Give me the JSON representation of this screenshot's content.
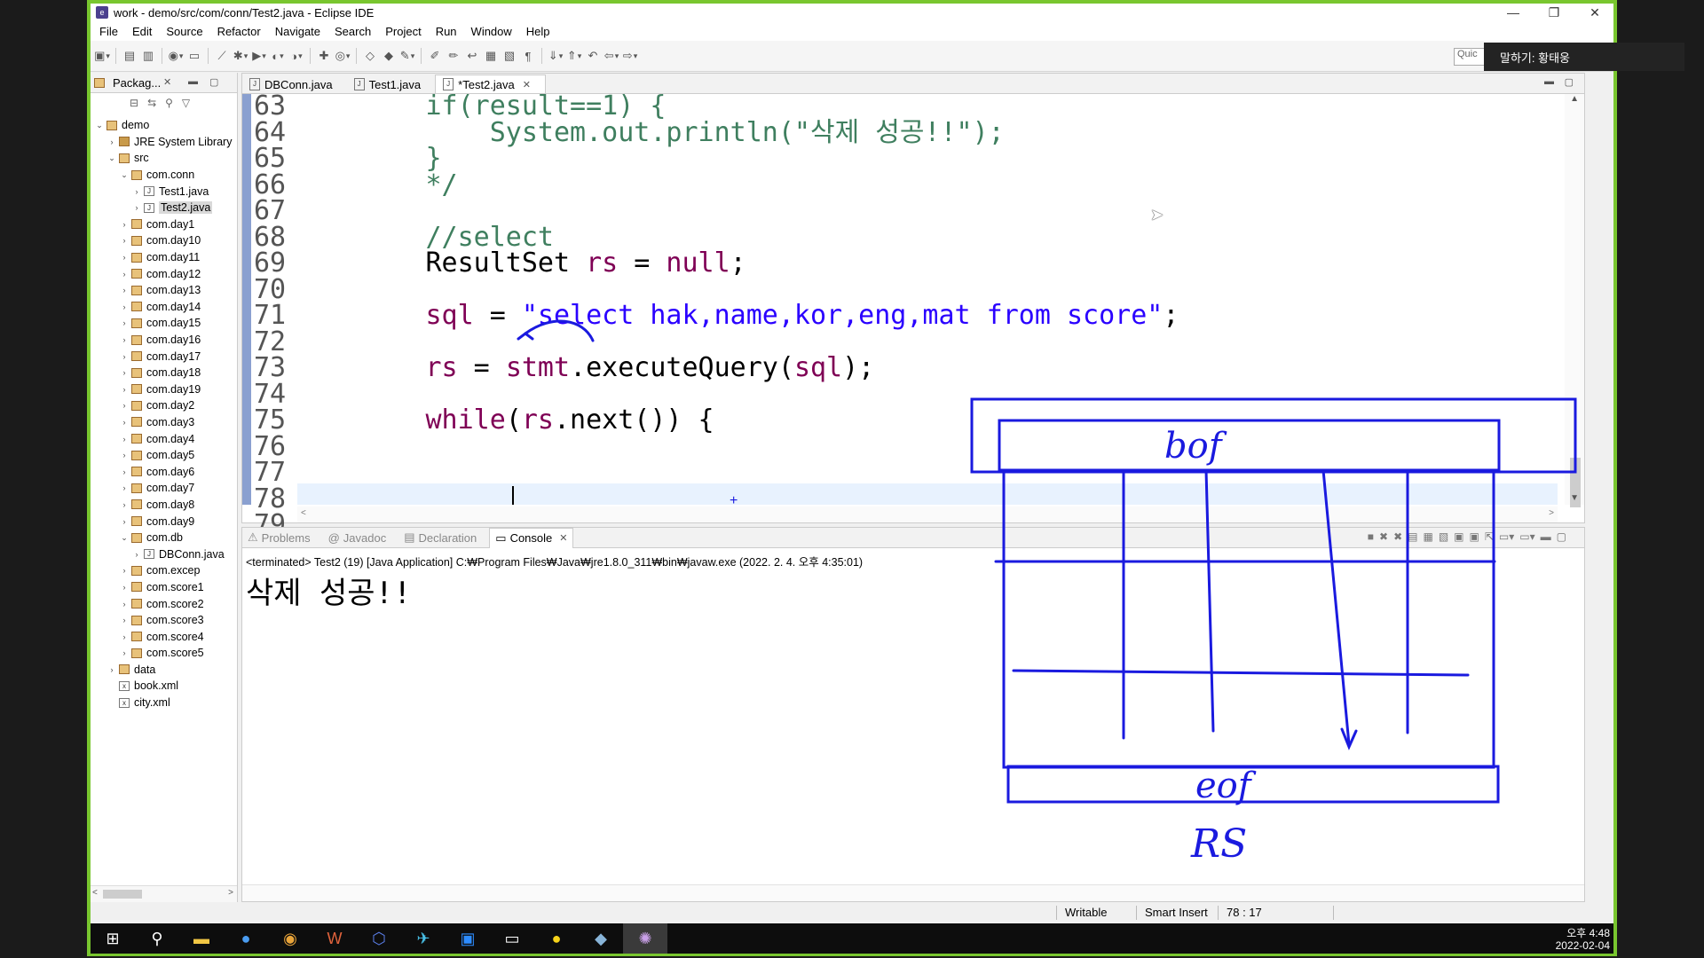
{
  "window": {
    "title": "work - demo/src/com/conn/Test2.java - Eclipse IDE",
    "controls": [
      "—",
      "❐",
      "✕"
    ]
  },
  "menu": [
    "File",
    "Edit",
    "Source",
    "Refactor",
    "Navigate",
    "Search",
    "Project",
    "Run",
    "Window",
    "Help"
  ],
  "quick_access": "Quic",
  "speaker": "말하기: 황태웅",
  "package_explorer": {
    "tab": "Packag...",
    "tree": [
      {
        "label": "demo",
        "depth": 0,
        "twisty": "v",
        "icon": "project-icon"
      },
      {
        "label": "JRE System Library",
        "depth": 1,
        "twisty": ">",
        "icon": "library-icon"
      },
      {
        "label": "src",
        "depth": 1,
        "twisty": "v",
        "icon": "source-folder-icon"
      },
      {
        "label": "com.conn",
        "depth": 2,
        "twisty": "v",
        "icon": "package-icon"
      },
      {
        "label": "Test1.java",
        "depth": 3,
        "twisty": ">",
        "icon": "java-file-icon"
      },
      {
        "label": "Test2.java",
        "depth": 3,
        "twisty": ">",
        "icon": "java-file-icon",
        "selected": true
      },
      {
        "label": "com.day1",
        "depth": 2,
        "twisty": ">",
        "icon": "package-icon"
      },
      {
        "label": "com.day10",
        "depth": 2,
        "twisty": ">",
        "icon": "package-icon"
      },
      {
        "label": "com.day11",
        "depth": 2,
        "twisty": ">",
        "icon": "package-icon"
      },
      {
        "label": "com.day12",
        "depth": 2,
        "twisty": ">",
        "icon": "package-icon"
      },
      {
        "label": "com.day13",
        "depth": 2,
        "twisty": ">",
        "icon": "package-icon"
      },
      {
        "label": "com.day14",
        "depth": 2,
        "twisty": ">",
        "icon": "package-icon"
      },
      {
        "label": "com.day15",
        "depth": 2,
        "twisty": ">",
        "icon": "package-icon"
      },
      {
        "label": "com.day16",
        "depth": 2,
        "twisty": ">",
        "icon": "package-icon"
      },
      {
        "label": "com.day17",
        "depth": 2,
        "twisty": ">",
        "icon": "package-icon"
      },
      {
        "label": "com.day18",
        "depth": 2,
        "twisty": ">",
        "icon": "package-icon"
      },
      {
        "label": "com.day19",
        "depth": 2,
        "twisty": ">",
        "icon": "package-icon"
      },
      {
        "label": "com.day2",
        "depth": 2,
        "twisty": ">",
        "icon": "package-icon"
      },
      {
        "label": "com.day3",
        "depth": 2,
        "twisty": ">",
        "icon": "package-icon"
      },
      {
        "label": "com.day4",
        "depth": 2,
        "twisty": ">",
        "icon": "package-icon"
      },
      {
        "label": "com.day5",
        "depth": 2,
        "twisty": ">",
        "icon": "package-icon"
      },
      {
        "label": "com.day6",
        "depth": 2,
        "twisty": ">",
        "icon": "package-icon"
      },
      {
        "label": "com.day7",
        "depth": 2,
        "twisty": ">",
        "icon": "package-icon"
      },
      {
        "label": "com.day8",
        "depth": 2,
        "twisty": ">",
        "icon": "package-icon"
      },
      {
        "label": "com.day9",
        "depth": 2,
        "twisty": ">",
        "icon": "package-icon"
      },
      {
        "label": "com.db",
        "depth": 2,
        "twisty": "v",
        "icon": "package-icon"
      },
      {
        "label": "DBConn.java",
        "depth": 3,
        "twisty": ">",
        "icon": "java-file-icon"
      },
      {
        "label": "com.excep",
        "depth": 2,
        "twisty": ">",
        "icon": "package-icon"
      },
      {
        "label": "com.score1",
        "depth": 2,
        "twisty": ">",
        "icon": "package-icon"
      },
      {
        "label": "com.score2",
        "depth": 2,
        "twisty": ">",
        "icon": "package-icon"
      },
      {
        "label": "com.score3",
        "depth": 2,
        "twisty": ">",
        "icon": "package-icon"
      },
      {
        "label": "com.score4",
        "depth": 2,
        "twisty": ">",
        "icon": "package-icon"
      },
      {
        "label": "com.score5",
        "depth": 2,
        "twisty": ">",
        "icon": "package-icon"
      },
      {
        "label": "data",
        "depth": 1,
        "twisty": ">",
        "icon": "folder-icon"
      },
      {
        "label": "book.xml",
        "depth": 1,
        "twisty": "",
        "icon": "xml-file-icon"
      },
      {
        "label": "city.xml",
        "depth": 1,
        "twisty": "",
        "icon": "xml-file-icon"
      }
    ]
  },
  "editor": {
    "tabs": [
      {
        "label": "DBConn.java",
        "active": false
      },
      {
        "label": "Test1.java",
        "active": false
      },
      {
        "label": "*Test2.java",
        "active": true
      }
    ],
    "lines": [
      {
        "num": "63",
        "segments": [
          {
            "t": "        if(result==1) {",
            "c": "kwline"
          }
        ]
      },
      {
        "num": "64",
        "segments": [
          {
            "t": "            System.out.println(\"삭제 성공!!\");",
            "c": "cmt"
          }
        ]
      },
      {
        "num": "65",
        "segments": [
          {
            "t": "        }",
            "c": "cmt"
          }
        ]
      },
      {
        "num": "66",
        "segments": [
          {
            "t": "        */",
            "c": "cmt"
          }
        ]
      },
      {
        "num": "67",
        "segments": [
          {
            "t": "",
            "c": ""
          }
        ]
      },
      {
        "num": "68",
        "segments": [
          {
            "t": "        //select",
            "c": "cmt"
          }
        ]
      },
      {
        "num": "69",
        "segments": [
          {
            "t": "        ResultSet ",
            "c": ""
          },
          {
            "t": "rs",
            "c": "kw"
          },
          {
            "t": " = ",
            "c": ""
          },
          {
            "t": "null",
            "c": "kw"
          },
          {
            "t": ";",
            "c": ""
          }
        ]
      },
      {
        "num": "70",
        "segments": [
          {
            "t": "",
            "c": ""
          }
        ]
      },
      {
        "num": "71",
        "segments": [
          {
            "t": "        ",
            "c": ""
          },
          {
            "t": "sql",
            "c": "kw"
          },
          {
            "t": " = ",
            "c": ""
          },
          {
            "t": "\"select hak,name,kor,eng,mat from score\"",
            "c": "str"
          },
          {
            "t": ";",
            "c": ""
          }
        ]
      },
      {
        "num": "72",
        "segments": [
          {
            "t": "",
            "c": ""
          }
        ]
      },
      {
        "num": "73",
        "segments": [
          {
            "t": "        ",
            "c": ""
          },
          {
            "t": "rs",
            "c": "kw"
          },
          {
            "t": " = ",
            "c": ""
          },
          {
            "t": "stmt",
            "c": "kw"
          },
          {
            "t": ".executeQuery(",
            "c": ""
          },
          {
            "t": "sql",
            "c": "kw"
          },
          {
            "t": ");",
            "c": ""
          }
        ]
      },
      {
        "num": "74",
        "segments": [
          {
            "t": "",
            "c": ""
          }
        ]
      },
      {
        "num": "75",
        "segments": [
          {
            "t": "        ",
            "c": ""
          },
          {
            "t": "while",
            "c": "kw"
          },
          {
            "t": "(",
            "c": ""
          },
          {
            "t": "rs",
            "c": "kw"
          },
          {
            "t": ".next()) {",
            "c": ""
          }
        ]
      },
      {
        "num": "76",
        "segments": [
          {
            "t": "",
            "c": ""
          }
        ]
      },
      {
        "num": "77",
        "segments": [
          {
            "t": "",
            "c": ""
          }
        ]
      },
      {
        "num": "78",
        "segments": [
          {
            "t": "",
            "c": ""
          }
        ],
        "current": true
      },
      {
        "num": "79",
        "segments": [
          {
            "t": "        }",
            "c": ""
          }
        ]
      }
    ]
  },
  "console": {
    "tabs": [
      {
        "label": "Problems",
        "icon": "problems-icon",
        "active": false
      },
      {
        "label": "Javadoc",
        "icon": "javadoc-icon",
        "active": false
      },
      {
        "label": "Declaration",
        "icon": "declaration-icon",
        "active": false
      },
      {
        "label": "Console",
        "icon": "console-icon",
        "active": true
      }
    ],
    "terminated": "<terminated> Test2 (19) [Java Application] C:₩Program Files₩Java₩jre1.8.0_311₩bin₩javaw.exe (2022. 2. 4. 오후 4:35:01)",
    "output": "삭제 성공!!"
  },
  "status": {
    "writable": "Writable",
    "insert_mode": "Smart Insert",
    "position": "78 : 17"
  },
  "annotations": {
    "bof": "bof",
    "eof": "eof",
    "rs": "RS"
  },
  "taskbar": {
    "time": "오후 4:48",
    "date": "2022-02-04",
    "apps": [
      "start-icon",
      "search-icon",
      "file-explorer-icon",
      "app-icon",
      "chrome-icon",
      "app-icon",
      "app-icon",
      "app-icon",
      "zoom-icon",
      "terminal-icon",
      "kakao-icon",
      "app-icon",
      "eclipse-icon"
    ]
  },
  "colors": {
    "keyword": "#7f0055",
    "string": "#2a00ff",
    "comment": "#3f7f5f",
    "ink": "#1a1adf",
    "frame": "#79c62f"
  }
}
